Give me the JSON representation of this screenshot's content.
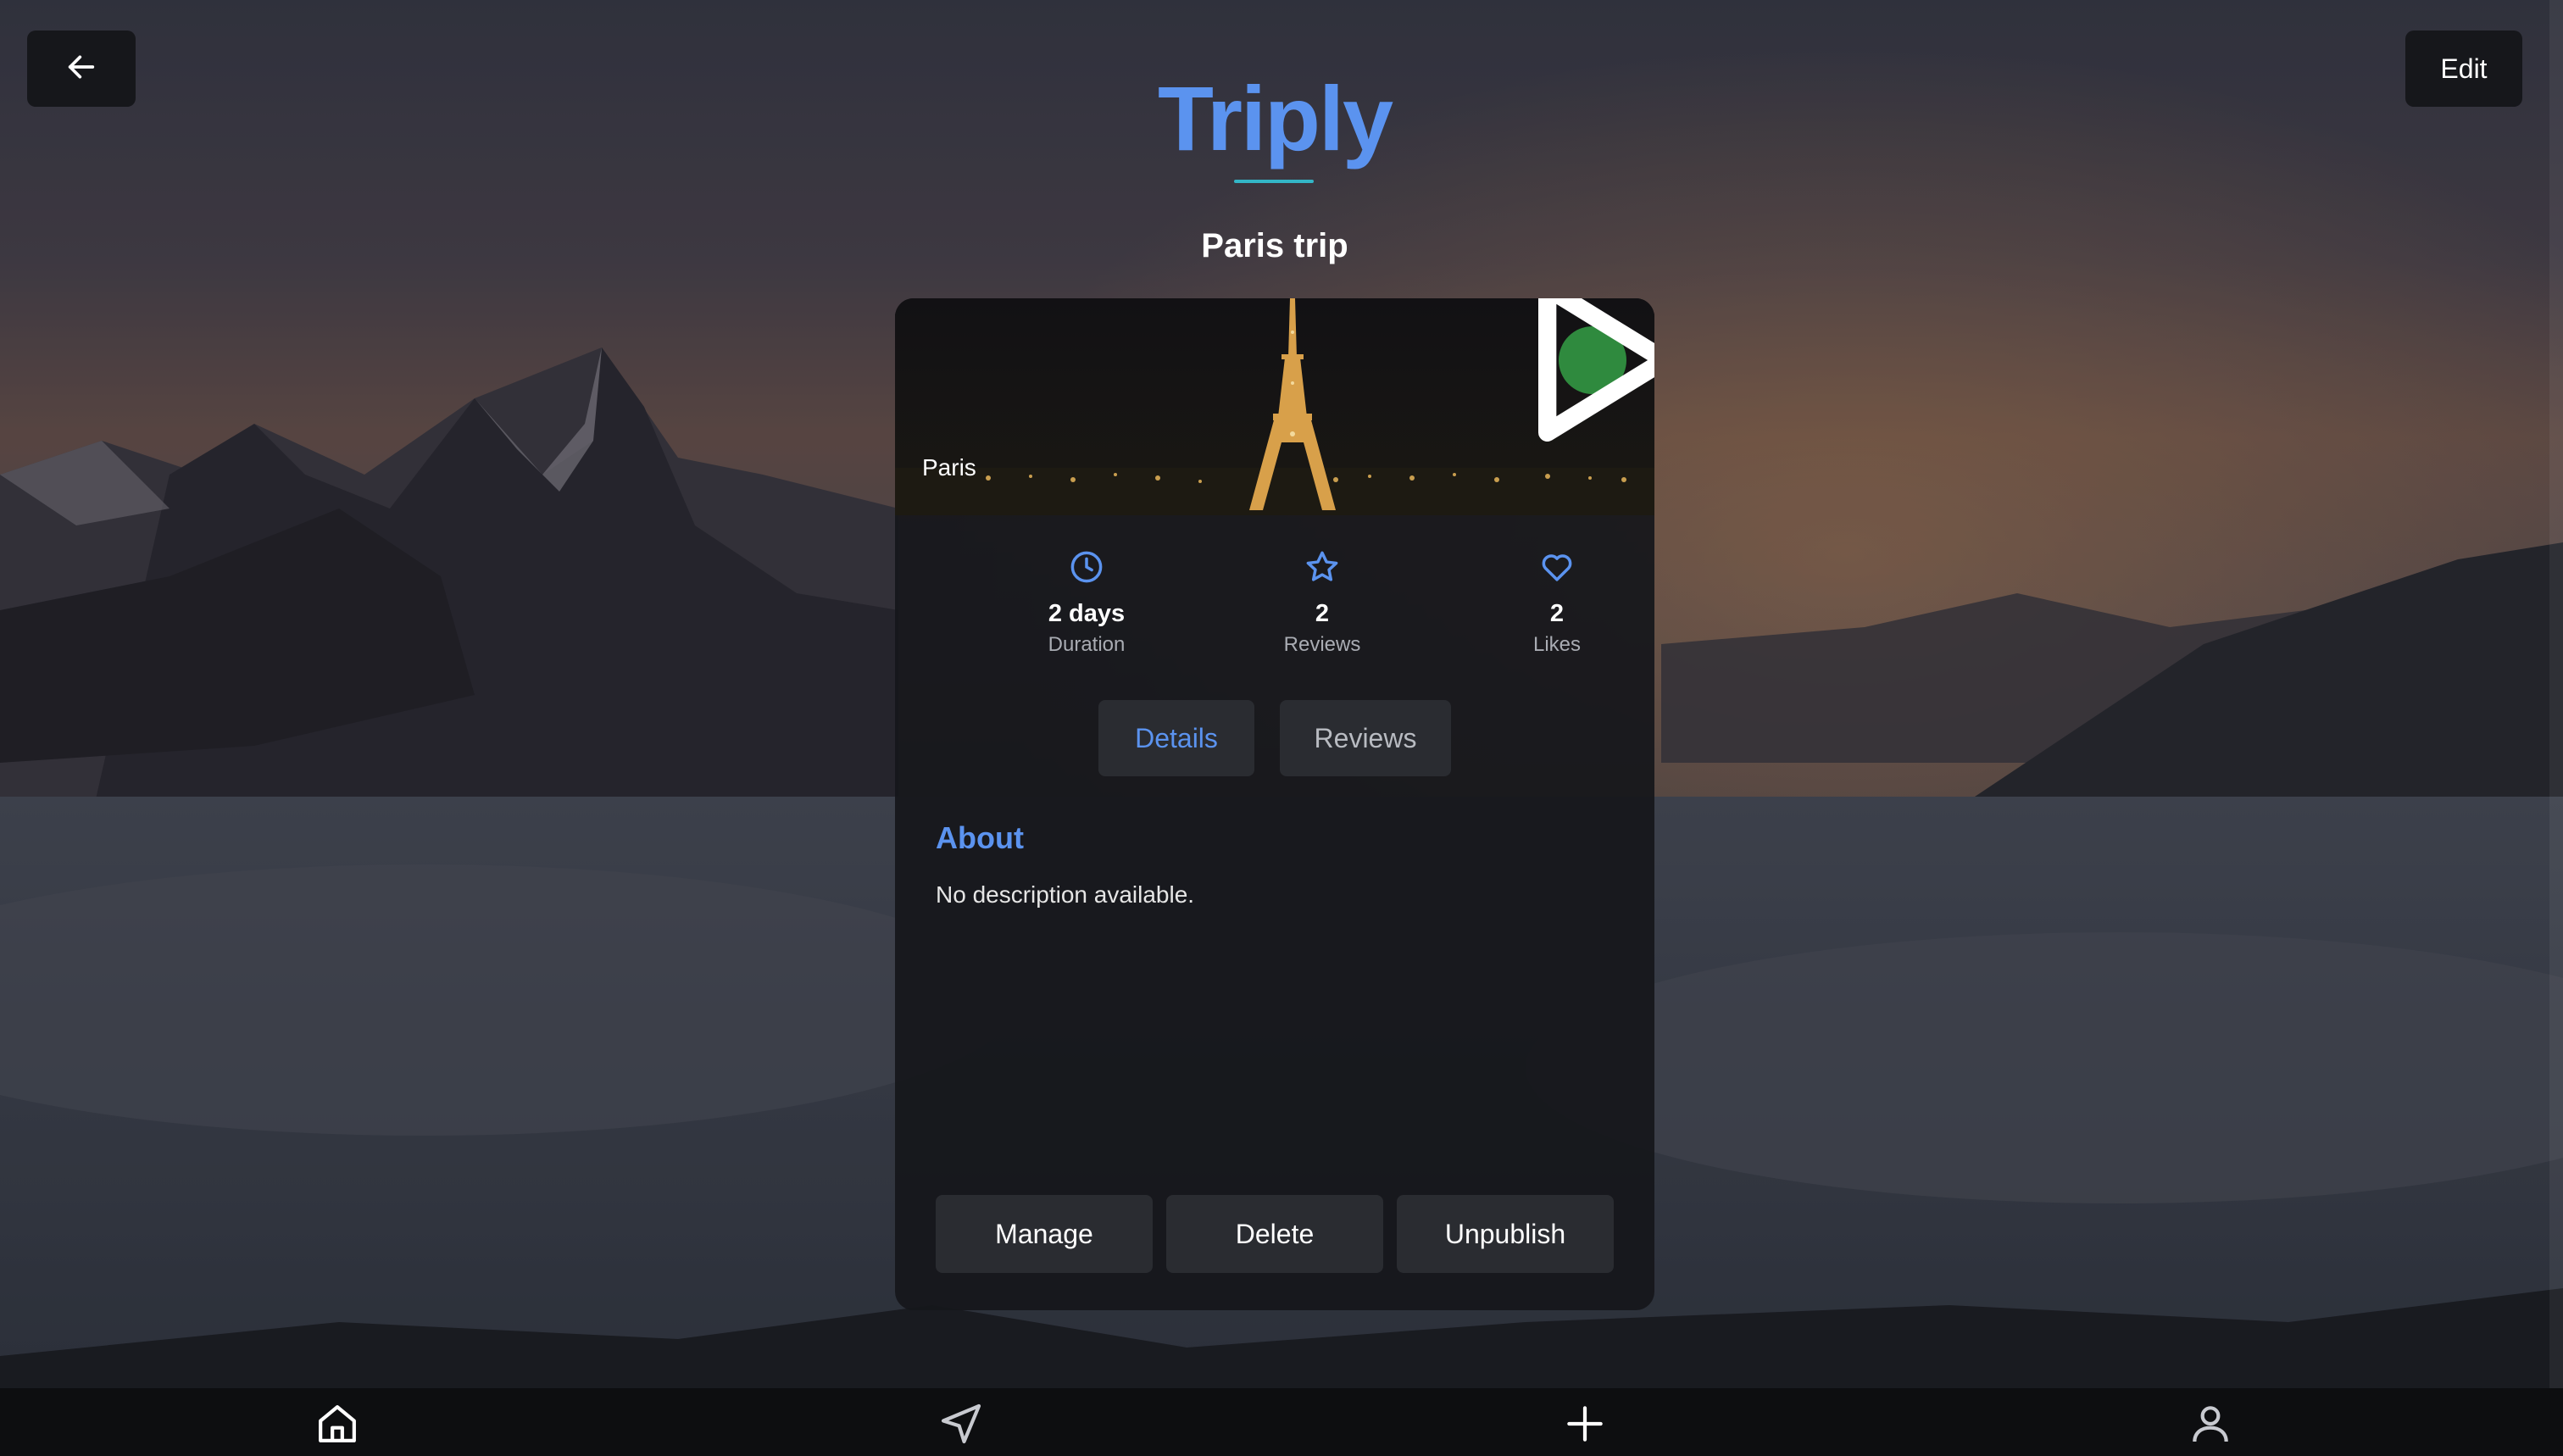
{
  "header": {
    "back_icon": "arrow-left-icon",
    "edit_label": "Edit",
    "logo_text": "Triply",
    "trip_title": "Paris trip"
  },
  "card": {
    "hero": {
      "location_label": "Paris",
      "play_icon": "play-icon"
    },
    "stats": [
      {
        "icon": "clock-icon",
        "value": "2 days",
        "label": "Duration"
      },
      {
        "icon": "star-icon",
        "value": "2",
        "label": "Reviews"
      },
      {
        "icon": "heart-icon",
        "value": "2",
        "label": "Likes"
      }
    ],
    "tabs": [
      {
        "label": "Details",
        "active": true
      },
      {
        "label": "Reviews",
        "active": false
      }
    ],
    "about": {
      "title": "About",
      "text": "No description available."
    },
    "actions": {
      "manage": "Manage",
      "delete": "Delete",
      "unpublish": "Unpublish"
    }
  },
  "bottom_nav": [
    {
      "icon": "home-icon"
    },
    {
      "icon": "navigation-icon"
    },
    {
      "icon": "plus-icon"
    },
    {
      "icon": "user-icon"
    }
  ],
  "colors": {
    "accent": "#5b93ef",
    "play_button": "#2f8a3e",
    "logo_underline": "#33b6c7"
  }
}
